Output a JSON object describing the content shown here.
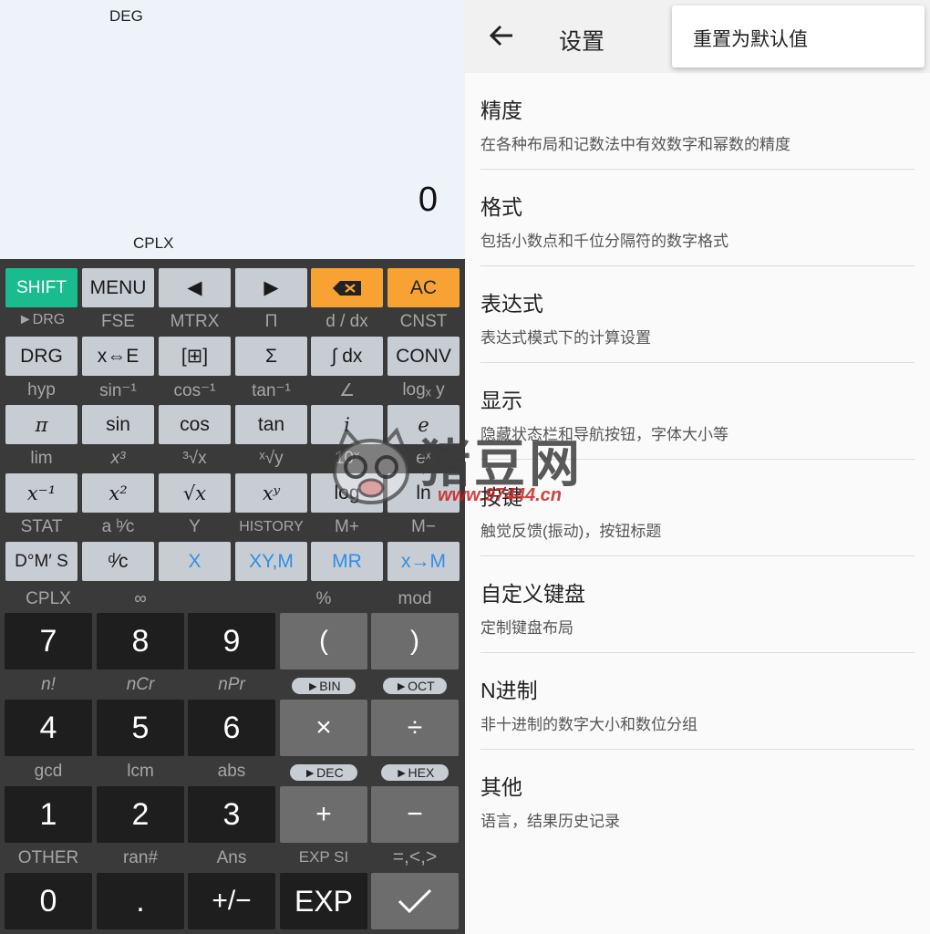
{
  "calculator": {
    "display": {
      "angle_mode": "DEG",
      "value": "0",
      "mode": "CPLX"
    },
    "row1": [
      "SHIFT",
      "MENU",
      "◀",
      "▶",
      "⌫",
      "AC"
    ],
    "labels1": [
      "►DRG",
      "FSE",
      "MTRX",
      "Π",
      "d / dx",
      "CNST"
    ],
    "row2": [
      "DRG",
      "x⇔E",
      "[⊞]",
      "Σ",
      "∫ dx",
      "CONV"
    ],
    "labels2": [
      "hyp",
      "sin⁻¹",
      "cos⁻¹",
      "tan⁻¹",
      "∠",
      "logₓ y"
    ],
    "row3": [
      "π",
      "sin",
      "cos",
      "tan",
      "i",
      "e"
    ],
    "labels3": [
      "lim",
      "x³",
      "³√x",
      "ˣ√y",
      "10ˣ",
      "eˣ"
    ],
    "row4": [
      "x⁻¹",
      "x²",
      "√x",
      "xʸ",
      "log",
      "ln"
    ],
    "labels4": [
      "STAT",
      "a ᵇ⁄c",
      "Y",
      "HISTORY",
      "M+",
      "M−"
    ],
    "row5": [
      "D°M′ S",
      "ᵈ⁄c",
      "X",
      "XY,M",
      "MR",
      "x→M"
    ],
    "labels5": [
      "CPLX",
      "∞",
      "",
      "%",
      "mod"
    ],
    "row6": [
      "7",
      "8",
      "9",
      "(",
      ")"
    ],
    "labels6": [
      "n!",
      "nCr",
      "nPr"
    ],
    "pills6": [
      "►BIN",
      "►OCT"
    ],
    "row7": [
      "4",
      "5",
      "6",
      "×",
      "÷"
    ],
    "labels7": [
      "gcd",
      "lcm",
      "abs"
    ],
    "pills7": [
      "►DEC",
      "►HEX"
    ],
    "row8": [
      "1",
      "2",
      "3",
      "+",
      "−"
    ],
    "labels8": [
      "OTHER",
      "ran#",
      "Ans",
      "EXP SI",
      "=,<,>"
    ],
    "row9": [
      "0",
      ".",
      "+/−",
      "EXP",
      "✓"
    ]
  },
  "settings": {
    "title": "设置",
    "menu_item": "重置为默认值",
    "items": [
      {
        "title": "精度",
        "desc": "在各种布局和记数法中有效数字和幂数的精度"
      },
      {
        "title": "格式",
        "desc": "包括小数点和千位分隔符的数字格式"
      },
      {
        "title": "表达式",
        "desc": "表达式模式下的计算设置"
      },
      {
        "title": "显示",
        "desc": "隐藏状态栏和导航按钮，字体大小等"
      },
      {
        "title": "按键",
        "desc": "触觉反馈(振动)，按钮标题"
      },
      {
        "title": "自定义键盘",
        "desc": "定制键盘布局"
      },
      {
        "title": "N进制",
        "desc": "非十进制的数字大小和数位分组"
      },
      {
        "title": "其他",
        "desc": "语言，结果历史记录"
      }
    ]
  },
  "watermark": {
    "text": "猪豆网",
    "url": "www.97444.cn"
  }
}
